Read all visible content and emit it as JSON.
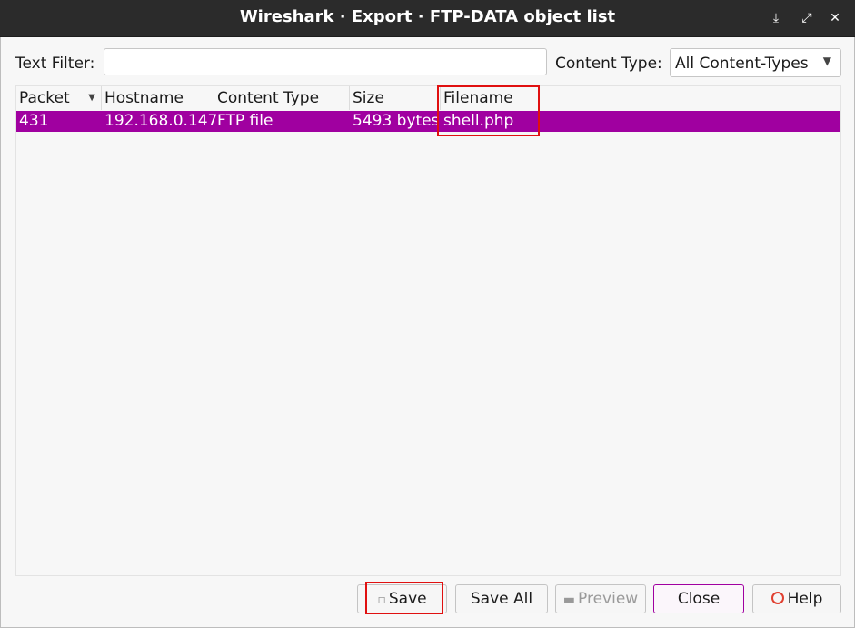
{
  "window": {
    "title": "Wireshark · Export · FTP-DATA object list",
    "min_glyph": "⤓",
    "max_glyph": "⤢",
    "close_glyph": "✕"
  },
  "filter": {
    "text_label": "Text Filter:",
    "text_value": "",
    "text_placeholder": "",
    "content_type_label": "Content Type:",
    "content_type_value": "All Content-Types"
  },
  "table": {
    "columns": [
      "Packet",
      "Hostname",
      "Content Type",
      "Size",
      "Filename"
    ],
    "sort_indicator": "▼",
    "rows": [
      {
        "packet": "431",
        "hostname": "192.168.0.147",
        "content_type": "FTP file",
        "size": "5493 bytes",
        "filename": "shell.php"
      }
    ],
    "selected_row_color": "#a000a0"
  },
  "buttons": {
    "save": "Save",
    "save_all": "Save All",
    "preview": "Preview",
    "close": "Close",
    "help": "Help"
  },
  "highlight_color": "#e01010"
}
